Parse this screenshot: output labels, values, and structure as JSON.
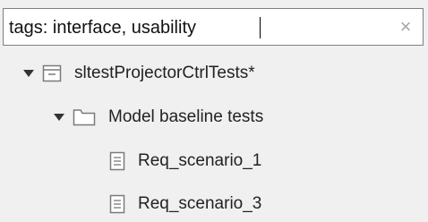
{
  "search": {
    "value": "tags: interface, usability",
    "clear_icon": "close-icon",
    "clear_glyph": "×"
  },
  "tree": {
    "root": {
      "label": "sltestProjectorCtrlTests*",
      "icon": "test-file-icon",
      "expanded": true
    },
    "suite": {
      "label": "Model baseline tests",
      "icon": "folder-icon",
      "expanded": true
    },
    "cases": [
      {
        "label": "Req_scenario_1",
        "icon": "test-case-icon"
      },
      {
        "label": "Req_scenario_3",
        "icon": "test-case-icon"
      }
    ]
  },
  "colors": {
    "background": "#f0f0f0",
    "input_border": "#7f7f7f",
    "icon_stroke": "#7a7a7a"
  }
}
